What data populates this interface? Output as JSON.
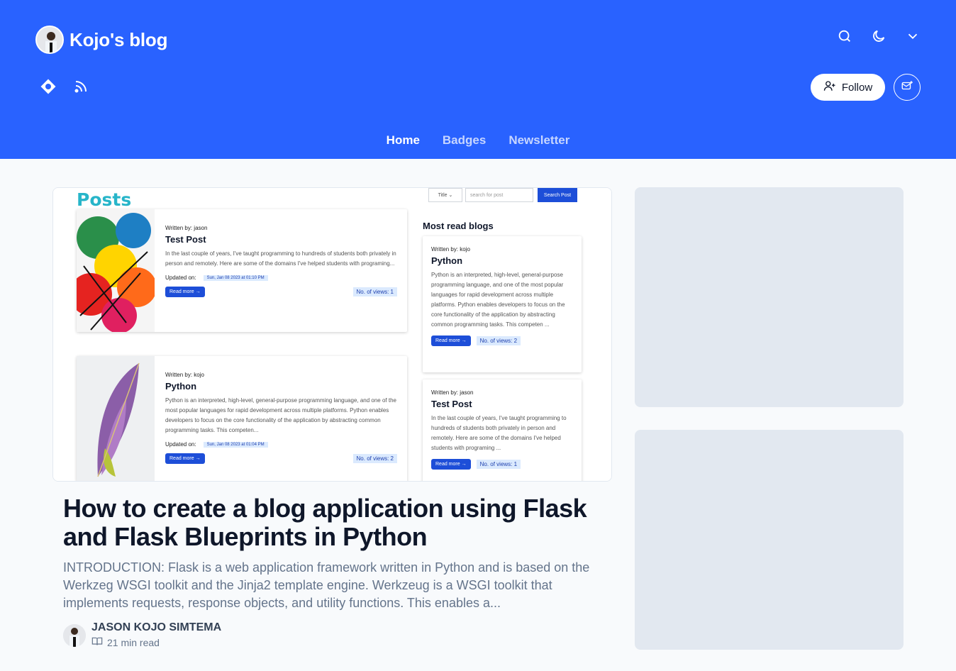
{
  "header": {
    "blog_title": "Kojo's blog",
    "follow_label": "Follow",
    "nav": {
      "home": "Home",
      "badges": "Badges",
      "newsletter": "Newsletter"
    }
  },
  "thumbnail": {
    "posts_heading": "Posts",
    "search": {
      "select_label": "Title",
      "placeholder": "search for post",
      "button": "Search Post"
    },
    "most_read_heading": "Most read blogs",
    "posts": [
      {
        "written_by": "Written by: jason",
        "title": "Test Post",
        "excerpt": "In the last couple of years, I've taught programming to hundreds of students both privately in person and remotely. Here are some of the domains I've helped students with programing...",
        "updated_label": "Updated on:",
        "updated": "Sun, Jan 08 2023 at 01:10 PM",
        "read_more": "Read more",
        "views": "No. of views: 1"
      },
      {
        "written_by": "Written by: kojo",
        "title": "Python",
        "excerpt": "Python is an interpreted, high-level, general-purpose programming language, and one of the most popular languages for rapid development across multiple platforms. Python enables developers to focus on the core functionality of the application by abstracting common programming tasks. This competen...",
        "updated_label": "Updated on:",
        "updated": "Sun, Jan 08 2023 at 01:04 PM",
        "read_more": "Read more",
        "views": "No. of views: 2"
      }
    ],
    "most_read": [
      {
        "written_by": "Written by: kojo",
        "title": "Python",
        "excerpt": "Python is an interpreted, high-level, general-purpose programming language, and one of the most popular languages for rapid development across multiple platforms. Python enables developers to focus on the core functionality of the application by abstracting common programming tasks. This competen ...",
        "read_more": "Read more",
        "views": "No. of views: 2"
      },
      {
        "written_by": "Written by: jason",
        "title": "Test Post",
        "excerpt": "In the last couple of years, I've taught programming to hundreds of students both privately in person and remotely. Here are some of the domains I've helped students with programing ...",
        "read_more": "Read more",
        "views": "No. of views: 1"
      }
    ]
  },
  "article": {
    "title": "How to create a blog application using Flask and Flask Blueprints in Python",
    "excerpt": "INTRODUCTION: Flask is a web application framework written in Python and is based on the Werkzeg WSGI toolkit and the Jinja2 template engine. Werkzeug is a WSGI toolkit that implements requests, response objects, and utility functions. This enables a...",
    "author": "JASON KOJO SIMTEMA",
    "read_time": "21 min read"
  },
  "colors": {
    "header_bg": "#2962ff",
    "accent": "#1d4ed8",
    "posts_heading": "#27b5c9"
  }
}
